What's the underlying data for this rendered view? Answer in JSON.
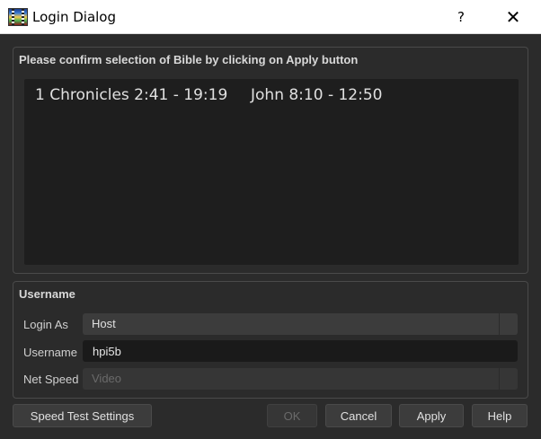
{
  "window": {
    "title": "Login Dialog",
    "help_glyph": "?",
    "close_glyph": "✕"
  },
  "bible_group": {
    "title": "Please confirm selection of Bible by clicking on Apply button",
    "items": [
      "1 Chronicles 2:41 - 19:19",
      "John 8:10 - 12:50"
    ]
  },
  "user_group": {
    "title": "Username",
    "login_as": {
      "label": "Login As",
      "value": "Host"
    },
    "username": {
      "label": "Username",
      "value": "hpi5b"
    },
    "net_speed": {
      "label": "Net Speed",
      "value": "Video"
    }
  },
  "buttons": {
    "speed_test": "Speed Test Settings",
    "ok": "OK",
    "cancel": "Cancel",
    "apply": "Apply",
    "help": "Help"
  },
  "colors": {
    "window_bg": "#2b2b2b",
    "list_bg": "#1e1e1e",
    "titlebar_bg": "#ffffff"
  },
  "icons": {
    "app": "app-icon",
    "help": "help-icon",
    "close": "close-icon",
    "dropdown": "dropdown-arrow-icon"
  }
}
